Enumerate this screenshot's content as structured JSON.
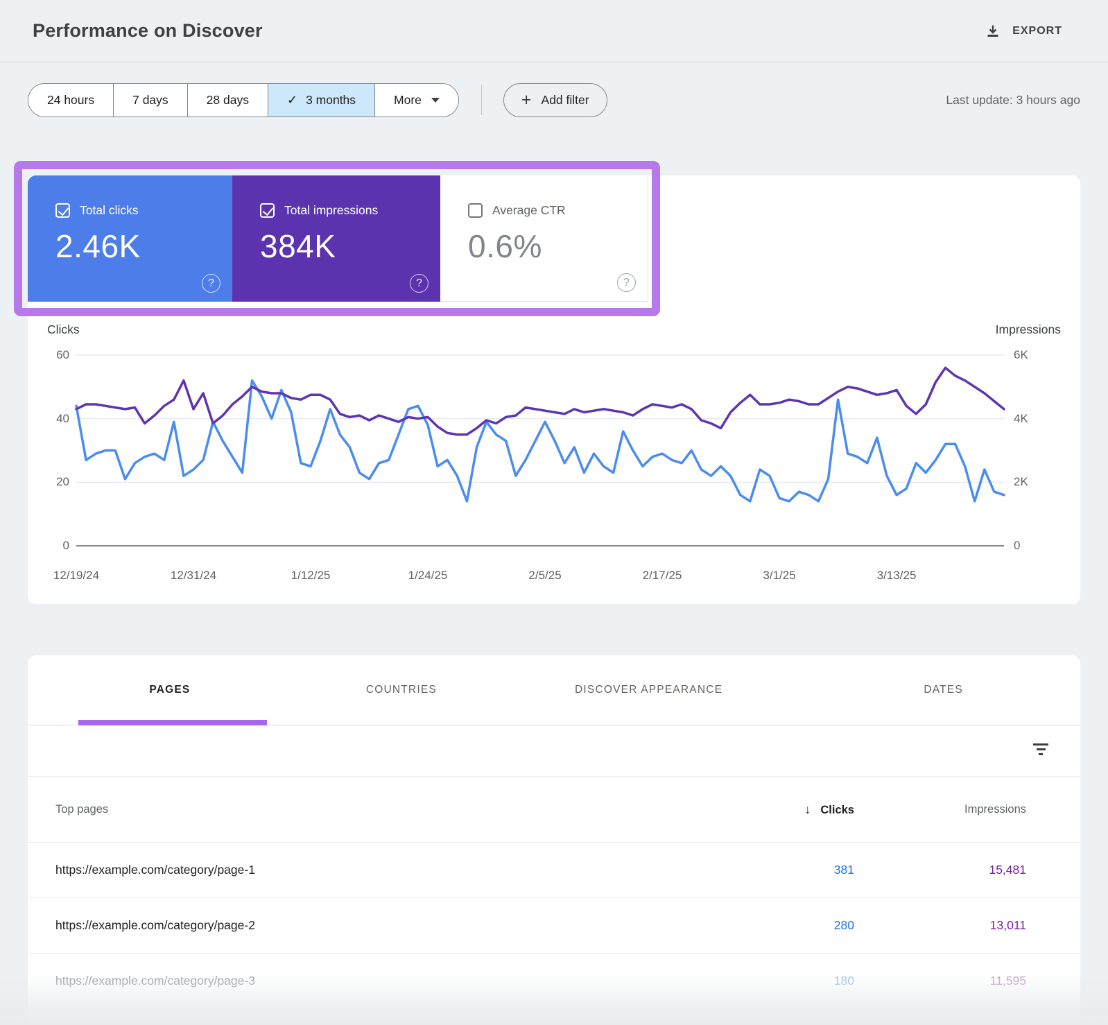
{
  "header": {
    "title": "Performance on Discover",
    "export_label": "EXPORT"
  },
  "controls": {
    "ranges": [
      {
        "label": "24 hours",
        "selected": false
      },
      {
        "label": "7 days",
        "selected": false
      },
      {
        "label": "28 days",
        "selected": false
      },
      {
        "label": "3 months",
        "selected": true
      },
      {
        "label": "More",
        "selected": false,
        "dropdown": true
      }
    ],
    "add_filter_label": "Add filter",
    "last_update": "Last update: 3 hours ago"
  },
  "metrics": {
    "cards": [
      {
        "label": "Total clicks",
        "value": "2.46K",
        "checked": true,
        "color": "#4D7DE9"
      },
      {
        "label": "Total impressions",
        "value": "384K",
        "checked": true,
        "color": "#5C33AE"
      },
      {
        "label": "Average CTR",
        "value": "0.6%",
        "checked": false,
        "color": "#FFFFFF"
      }
    ]
  },
  "chart_data": {
    "type": "line",
    "title": "Clicks and Impressions over time",
    "left_axis": {
      "title": "Clicks",
      "ticks": [
        "0",
        "20",
        "40",
        "60"
      ],
      "range": [
        0,
        60
      ]
    },
    "right_axis": {
      "title": "Impressions",
      "ticks": [
        "0",
        "2K",
        "4K",
        "6K"
      ],
      "range": [
        0,
        6000
      ]
    },
    "grid": true,
    "legend_position": "none",
    "total_days": 95,
    "x_ticks": [
      {
        "label": "12/19/24",
        "day": 0
      },
      {
        "label": "12/31/24",
        "day": 12
      },
      {
        "label": "1/12/25",
        "day": 24
      },
      {
        "label": "1/24/25",
        "day": 36
      },
      {
        "label": "2/5/25",
        "day": 48
      },
      {
        "label": "2/17/25",
        "day": 60
      },
      {
        "label": "3/1/25",
        "day": 72
      },
      {
        "label": "3/13/25",
        "day": 84
      }
    ],
    "series": [
      {
        "name": "Clicks",
        "axis": "left",
        "color": "#4A8CF0",
        "values": [
          44,
          27,
          29,
          30,
          30,
          21,
          26,
          28,
          29,
          27,
          39,
          22,
          24,
          27,
          39,
          33,
          28,
          23,
          52,
          47,
          40,
          49,
          42,
          26,
          25,
          33,
          43,
          35,
          31,
          23,
          21,
          26,
          27,
          35,
          43,
          44,
          38,
          25,
          27,
          22,
          14,
          31,
          39,
          35,
          33,
          22,
          27,
          33,
          39,
          33,
          26,
          31,
          23,
          29,
          25,
          23,
          36,
          30,
          25,
          28,
          29,
          27,
          26,
          30,
          24,
          22,
          25,
          22,
          16,
          14,
          24,
          22,
          15,
          14,
          17,
          16,
          14,
          21,
          46,
          29,
          28,
          26,
          34,
          22,
          16,
          18,
          26,
          23,
          27,
          32,
          32,
          25,
          14,
          24,
          17,
          16
        ]
      },
      {
        "name": "Impressions",
        "axis": "right",
        "color": "#5E35B1",
        "values": [
          4300,
          4450,
          4450,
          4400,
          4350,
          4300,
          4350,
          3850,
          4100,
          4400,
          4600,
          5200,
          4300,
          4800,
          3850,
          4100,
          4450,
          4700,
          5000,
          4850,
          4800,
          4800,
          4650,
          4600,
          4750,
          4750,
          4600,
          4150,
          4050,
          4100,
          3950,
          4100,
          4000,
          3900,
          4050,
          4000,
          4050,
          3750,
          3550,
          3500,
          3500,
          3700,
          3950,
          3850,
          4050,
          4100,
          4350,
          4300,
          4250,
          4200,
          4150,
          4300,
          4200,
          4250,
          4300,
          4250,
          4200,
          4100,
          4300,
          4450,
          4400,
          4350,
          4450,
          4300,
          3950,
          3850,
          3700,
          4200,
          4500,
          4750,
          4450,
          4450,
          4500,
          4600,
          4550,
          4450,
          4450,
          4650,
          4850,
          5000,
          4950,
          4850,
          4750,
          4800,
          4900,
          4400,
          4150,
          4450,
          5150,
          5600,
          5350,
          5200,
          5000,
          4800,
          4550,
          4300
        ]
      }
    ]
  },
  "table": {
    "tabs": [
      {
        "label": "PAGES",
        "active": true
      },
      {
        "label": "COUNTRIES",
        "active": false
      },
      {
        "label": "DISCOVER APPEARANCE",
        "active": false
      },
      {
        "label": "DATES",
        "active": false
      }
    ],
    "columns": {
      "pages": "Top pages",
      "clicks": "Clicks",
      "impressions": "Impressions"
    },
    "rows": [
      {
        "url": "https://example.com/category/page-1",
        "clicks": "381",
        "impressions": "15,481",
        "faded": false
      },
      {
        "url": "https://example.com/category/page-2",
        "clicks": "280",
        "impressions": "13,011",
        "faded": false
      },
      {
        "url": "https://example.com/category/page-3",
        "clicks": "180",
        "impressions": "11,595",
        "faded": true
      }
    ]
  },
  "colors": {
    "clicks_card": "#4D7DE9",
    "impressions_card": "#5C33AE",
    "clicks_line": "#4A8CF0",
    "impressions_line": "#5E35B1",
    "highlight_annotation": "#B678EA",
    "tab_underline": "#A566F0",
    "selected_range_bg": "#CDE7FB",
    "table_clicks_value": "#1A73E8",
    "table_impressions_value": "#7B1FA2"
  }
}
